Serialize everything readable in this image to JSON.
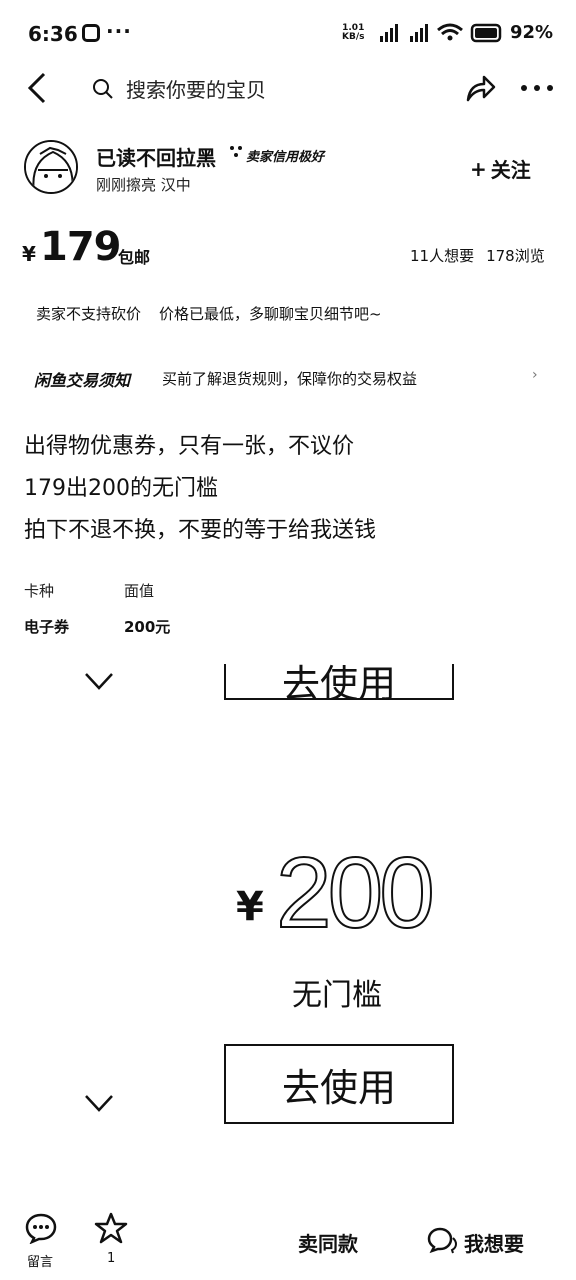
{
  "status_bar": {
    "time": "6:36",
    "dots": "···",
    "speed_top": "1.01",
    "speed_bottom": "KB/s",
    "battery": "92%"
  },
  "header": {
    "search_placeholder": "搜索你要的宝贝"
  },
  "seller": {
    "name": "已读不回拉黑",
    "credit": "卖家信用极好",
    "meta": "刚刚擦亮  汉中",
    "follow_label": "关注"
  },
  "price": {
    "currency": "¥",
    "amount": "179",
    "shipping": "包邮",
    "wants": "11人想要",
    "views": "178浏览"
  },
  "notice": {
    "no_bargain": "卖家不支持砍价",
    "hint": "价格已最低，多聊聊宝贝细节吧~"
  },
  "rules": {
    "logo": "闲鱼交易须知",
    "text": "买前了解退货规则，保障你的交易权益",
    "arrow": "›"
  },
  "description": [
    "出得物优惠券，只有一张，不议价",
    "179出200的无门槛",
    "拍下不退不换，不要的等于给我送钱"
  ],
  "specs": {
    "label1": "卡种",
    "value1": "电子券",
    "label2": "面值",
    "value2": "200元"
  },
  "coupon": {
    "top_button": "去使用",
    "yen": "¥",
    "value": "200",
    "condition": "无门槛",
    "button": "去使用"
  },
  "bottom_bar": {
    "comment_label": "留言",
    "fav_count": "1",
    "sell_same": "卖同款",
    "want": "我想要"
  }
}
